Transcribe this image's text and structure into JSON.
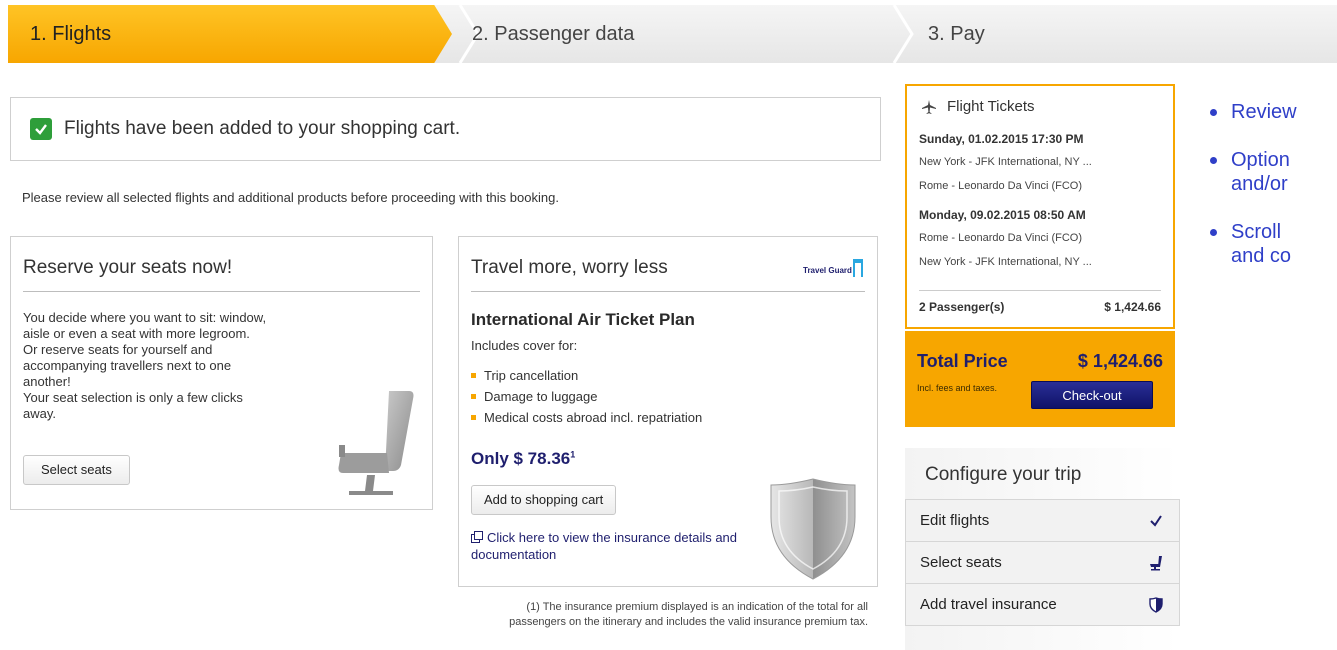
{
  "steps": [
    {
      "label": "1. Flights",
      "active": true
    },
    {
      "label": "2. Passenger data",
      "active": false
    },
    {
      "label": "3. Pay",
      "active": false
    }
  ],
  "confirmation": {
    "text": "Flights have been added to your shopping cart."
  },
  "review_note": "Please review all selected flights and additional products before proceeding with this booking.",
  "seat_card": {
    "title": "Reserve your seats now!",
    "lines": [
      "You decide where you want to sit: window,",
      "aisle or even a seat with more legroom.",
      "Or reserve seats for yourself and",
      "accompanying travellers next to one",
      "another!",
      "Your seat selection is only a few clicks",
      "away."
    ],
    "button": "Select seats"
  },
  "insurance_card": {
    "title": "Travel more, worry less",
    "logo": "Travel Guard",
    "plan": "International Air Ticket Plan",
    "covers_label": "Includes cover for:",
    "covers": [
      "Trip cancellation",
      "Damage to luggage",
      "Medical costs abroad incl. repatriation"
    ],
    "price": "Only $ 78.36",
    "price_note_mark": "1",
    "button": "Add to shopping cart",
    "details_link": "Click here to view the insurance details and documentation"
  },
  "footnote": "(1) The insurance premium displayed is an indication of the total for all passengers on the itinerary and includes the valid insurance premium tax.",
  "summary": {
    "title": "Flight Tickets",
    "legs": [
      {
        "date": "Sunday, 01.02.2015 17:30 PM",
        "from": "New York - JFK International, NY ...",
        "to": "Rome - Leonardo Da Vinci (FCO)"
      },
      {
        "date": "Monday, 09.02.2015 08:50 AM",
        "from": "Rome - Leonardo Da Vinci (FCO)",
        "to": "New York - JFK International, NY ..."
      }
    ],
    "passengers": "2 Passenger(s)",
    "passenger_total": "$ 1,424.66"
  },
  "total": {
    "label": "Total Price",
    "value": "$ 1,424.66",
    "note": "Incl. fees and taxes.",
    "button": "Check-out"
  },
  "configure": {
    "title": "Configure your trip",
    "items": [
      {
        "label": "Edit flights",
        "icon": "checkmark-icon"
      },
      {
        "label": "Select seats",
        "icon": "seat-icon"
      },
      {
        "label": "Add travel insurance",
        "icon": "shield-icon"
      }
    ]
  },
  "bullets": [
    "Review",
    "Option",
    "and/or",
    "Scroll",
    "and co"
  ],
  "colors": {
    "accent": "#f7a600",
    "navy": "#1f1f6e",
    "bullet_blue": "#2f3fc8",
    "success": "#2e9e3a"
  }
}
